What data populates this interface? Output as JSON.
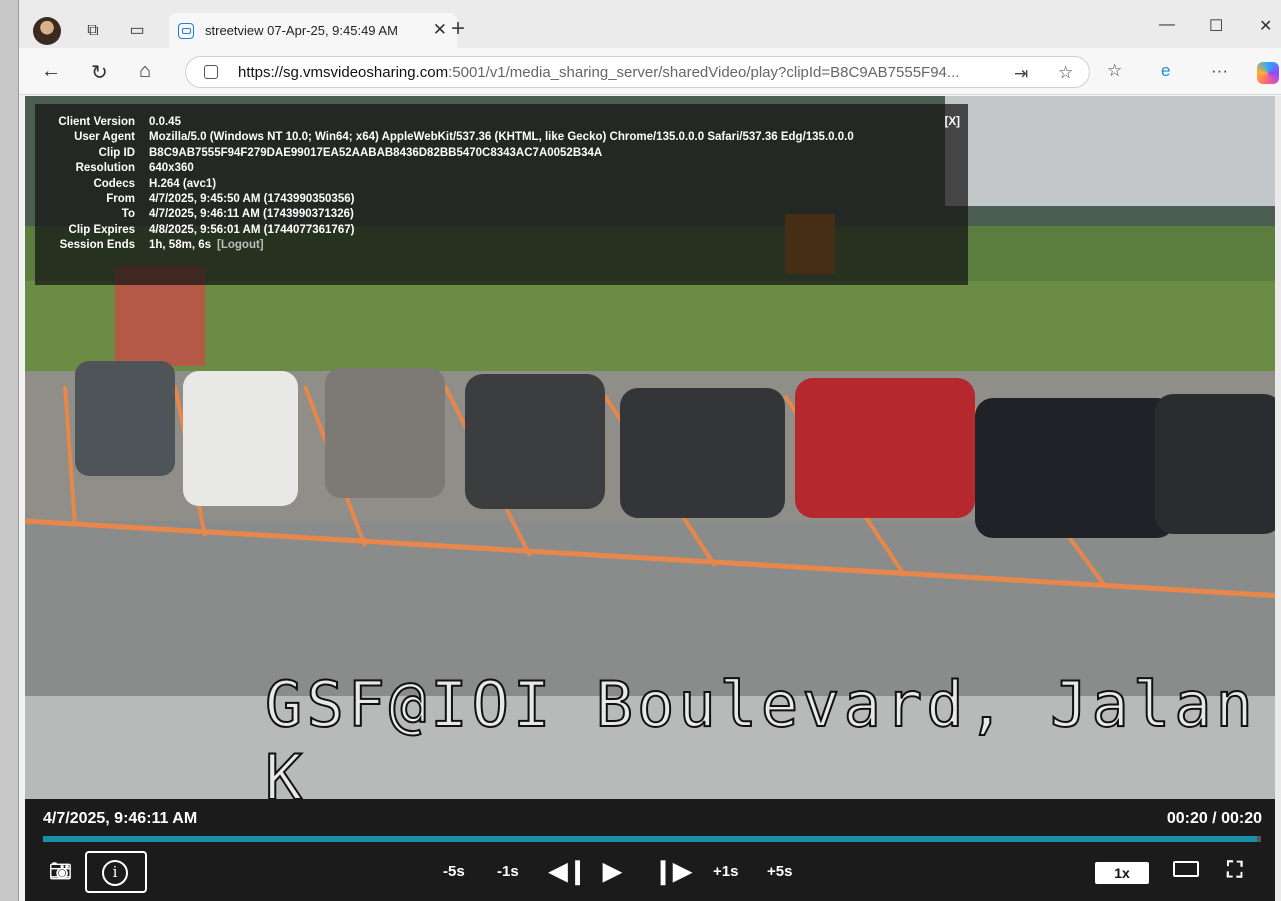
{
  "browser": {
    "tab_title": "streetview 07-Apr-25, 9:45:49 AM",
    "tab_close": "✕",
    "new_tab": "+",
    "url_host": "https://sg.vmsvideosharing.com",
    "url_path": ":5001/v1/media_sharing_server/sharedVideo/play?clipId=B8C9AB7555F94..."
  },
  "video": {
    "overlay_caption": "GSF@IOI Boulevard, Jalan K"
  },
  "info_panel": {
    "close": "[X]",
    "rows": [
      {
        "key": "Client Version",
        "value": "0.0.45"
      },
      {
        "key": "User Agent",
        "value": "Mozilla/5.0 (Windows NT 10.0; Win64; x64) AppleWebKit/537.36 (KHTML, like Gecko) Chrome/135.0.0.0 Safari/537.36 Edg/135.0.0.0"
      },
      {
        "key": "Clip ID",
        "value": "B8C9AB7555F94F279DAE99017EA52AABAB8436D82BB5470C8343AC7A0052B34A"
      },
      {
        "key": "Resolution",
        "value": "640x360"
      },
      {
        "key": "Codecs",
        "value": "H.264 (avc1)"
      },
      {
        "key": "From",
        "value": "4/7/2025, 9:45:50 AM (1743990350356)"
      },
      {
        "key": "To",
        "value": "4/7/2025, 9:46:11 AM (1743990371326)"
      },
      {
        "key": "Clip Expires",
        "value": "4/8/2025, 9:56:01 AM (1744077361767)"
      },
      {
        "key": "Session Ends",
        "value": "1h, 58m, 6s"
      }
    ],
    "logout": "[Logout]"
  },
  "player": {
    "timestamp": "4/7/2025, 9:46:11 AM",
    "duration": "00:20 / 00:20",
    "progress": 0.997,
    "back5": "-5s",
    "back1": "-1s",
    "fwd1": "+1s",
    "fwd5": "+5s",
    "speed": "1x"
  }
}
